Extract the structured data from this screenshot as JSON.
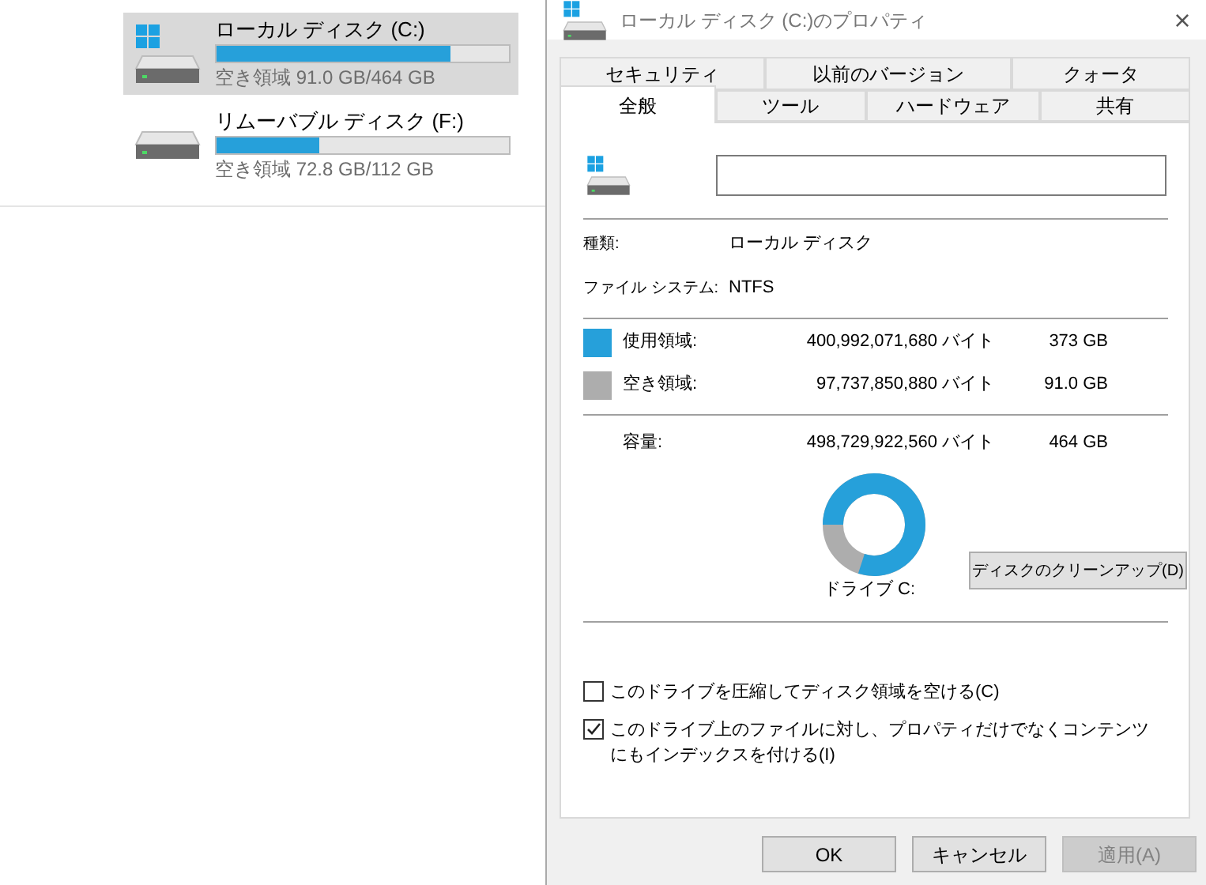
{
  "drives": [
    {
      "name": "ローカル ディスク (C:)",
      "free_text": "空き領域 91.0 GB/464 GB",
      "level": 0.8,
      "selected": true,
      "kind": "system"
    },
    {
      "name": "リムーバブル ディスク (F:)",
      "free_text": "空き領域 72.8 GB/112 GB",
      "level": 0.35,
      "selected": false,
      "kind": "removable"
    }
  ],
  "dialog": {
    "title": "ローカル ディスク (C:)のプロパティ",
    "close": "×",
    "tab_rows": [
      [
        {
          "label": "セキュリティ",
          "selected": false
        },
        {
          "label": "以前のバージョン",
          "selected": false
        },
        {
          "label": "クォータ",
          "selected": false
        }
      ],
      [
        {
          "label": "全般",
          "selected": true
        },
        {
          "label": "ツール",
          "selected": false
        },
        {
          "label": "ハードウェア",
          "selected": false
        },
        {
          "label": "共有",
          "selected": false
        }
      ]
    ],
    "info": [
      {
        "label": "種類:",
        "value": "ローカル ディスク"
      },
      {
        "label": "ファイル システム:",
        "value": "NTFS"
      }
    ],
    "space": [
      {
        "label": "使用領域:",
        "bytes": "400,992,071,680 バイト",
        "size": "373 GB",
        "color": "#26a0da"
      },
      {
        "label": "空き領域:",
        "bytes": "97,737,850,880 バイト",
        "size": "91.0 GB",
        "color": "#adadad"
      }
    ],
    "capacity": {
      "label": "容量:",
      "bytes": "498,729,922,560 バイト",
      "size": "464 GB"
    },
    "drive_label": "ドライブ C:",
    "cleanup_button": "ディスクのクリーンアップ(D)",
    "checkboxes": [
      {
        "label": "このドライブを圧縮してディスク領域を空ける(C)",
        "checked": false
      },
      {
        "label": "このドライブ上のファイルに対し、プロパティだけでなくコンテンツにもインデックスを付ける(I)",
        "checked": true
      }
    ],
    "buttons": [
      {
        "label": "OK",
        "disabled": false
      },
      {
        "label": "キャンセル",
        "disabled": false
      },
      {
        "label": "適用(A)",
        "disabled": true
      }
    ]
  }
}
